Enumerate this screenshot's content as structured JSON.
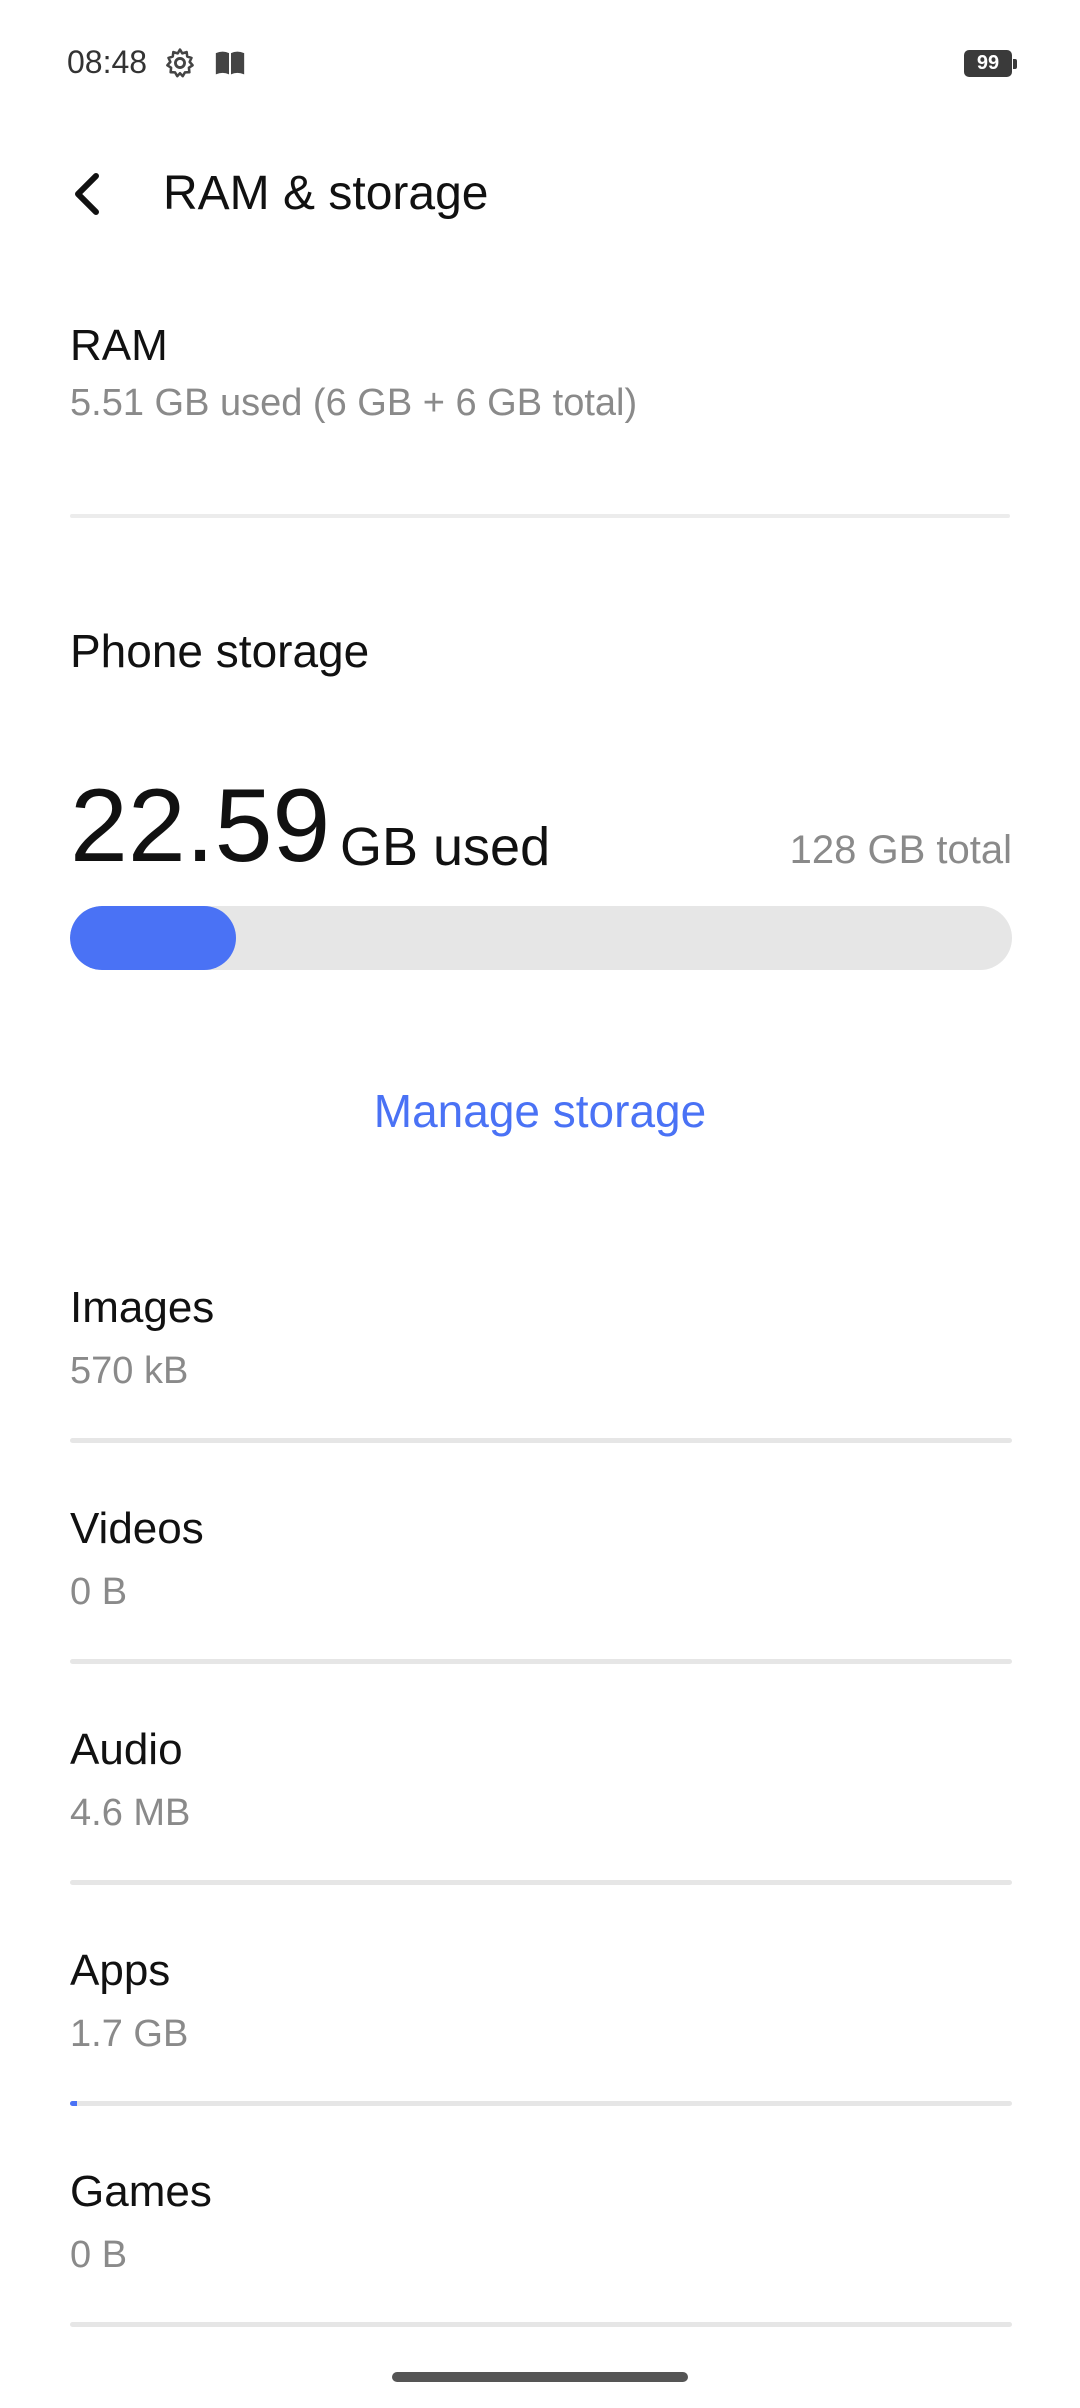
{
  "status_bar": {
    "time": "08:48",
    "icons": [
      "gear-icon",
      "book-icon"
    ],
    "battery": "99"
  },
  "header": {
    "title": "RAM & storage",
    "back_icon": "chevron-left-icon"
  },
  "ram": {
    "title": "RAM",
    "detail": "5.51 GB used (6 GB + 6 GB total)"
  },
  "phone_storage": {
    "label": "Phone storage",
    "used_value": "22.59",
    "used_unit": "GB used",
    "total": "128 GB total",
    "used_fraction": 0.1765,
    "accent_color": "#4a72f5"
  },
  "manage_button": {
    "label": "Manage storage"
  },
  "categories": [
    {
      "name": "Images",
      "size": "570 kB",
      "fill_fraction": 0.0
    },
    {
      "name": "Videos",
      "size": "0 B",
      "fill_fraction": 0.0
    },
    {
      "name": "Audio",
      "size": "4.6 MB",
      "fill_fraction": 0.0
    },
    {
      "name": "Apps",
      "size": "1.7 GB",
      "fill_fraction": 0.0075
    },
    {
      "name": "Games",
      "size": "0 B",
      "fill_fraction": 0.0
    }
  ]
}
